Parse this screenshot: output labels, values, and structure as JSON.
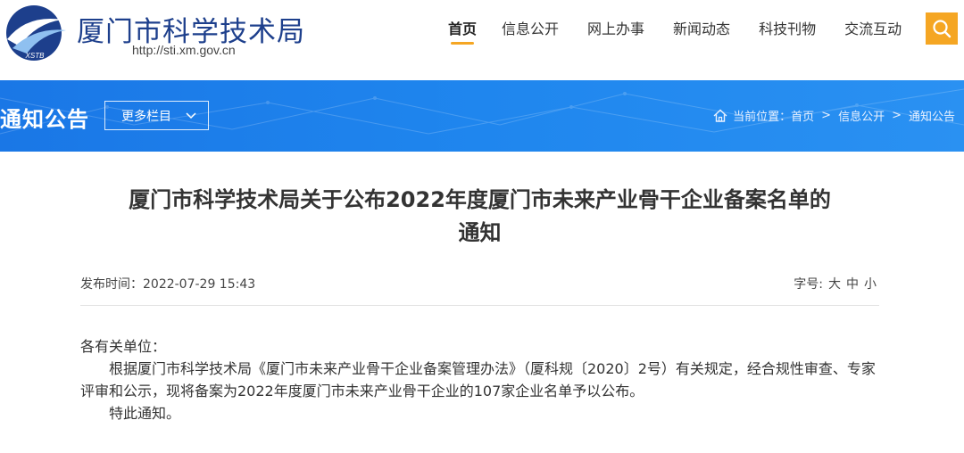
{
  "header": {
    "site_title": "厦门市科学技术局",
    "site_url": "http://sti.xm.gov.cn",
    "logo_text": "XSTB",
    "nav": [
      {
        "label": "首页",
        "active": true
      },
      {
        "label": "信息公开",
        "active": false
      },
      {
        "label": "网上办事",
        "active": false
      },
      {
        "label": "新闻动态",
        "active": false
      },
      {
        "label": "科技刊物",
        "active": false
      },
      {
        "label": "交流互动",
        "active": false
      }
    ],
    "search_icon": "search-icon"
  },
  "banner": {
    "title": "通知公告",
    "more_label": "更多栏目",
    "breadcrumb": {
      "prefix": "当前位置：",
      "items": [
        "首页",
        "信息公开",
        "通知公告"
      ],
      "separator": ">"
    }
  },
  "article": {
    "title_line1": "厦门市科学技术局关于公布2022年度厦门市未来产业骨干企业备案名单的",
    "title_line2": "通知",
    "published_label": "发布时间：",
    "published_value": "2022-07-29 15:43",
    "font_size_label": "字号:",
    "font_sizes": [
      "大",
      "中",
      "小"
    ],
    "salutation": "各有关单位：",
    "paragraph1": "根据厦门市科学技术局《厦门市未来产业骨干企业备案管理办法》（厦科规〔2020〕2号）有关规定，经合规性审查、专家评审和公示，现将备案为2022年度厦门市未来产业骨干企业的107家企业名单予以公布。",
    "paragraph2": "特此通知。"
  },
  "colors": {
    "brand_blue": "#1d3f8c",
    "banner_blue": "#1f86ee",
    "accent_orange": "#f5a623"
  }
}
